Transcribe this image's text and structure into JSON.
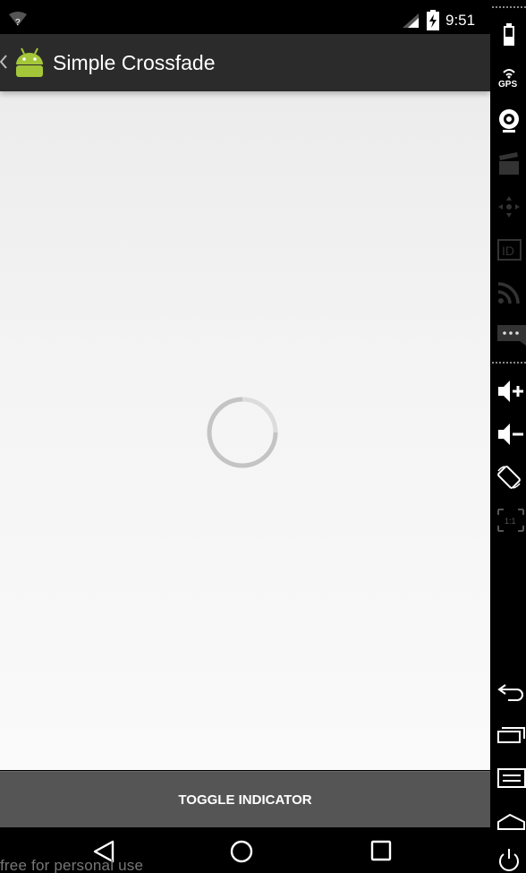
{
  "status_bar": {
    "wifi_badge": "?",
    "time": "9:51",
    "icons": [
      "wifi-icon",
      "signal-icon",
      "battery-charging-icon"
    ]
  },
  "action_bar": {
    "title": "Simple Crossfade",
    "icons": [
      "up-caret-icon",
      "android-app-icon"
    ]
  },
  "content": {
    "indicator": "progress-spinner"
  },
  "toggle_button": {
    "label": "TOGGLE INDICATOR"
  },
  "nav_bar": {
    "buttons": [
      "back-icon",
      "home-icon",
      "recents-icon"
    ]
  },
  "watermark": {
    "text": "free for personal use"
  },
  "side_panel": {
    "gps_label": "GPS",
    "id_label": "ID",
    "scale_label": "1:1",
    "icons": [
      "battery-icon",
      "gps-icon",
      "camera-icon",
      "clapperboard-icon",
      "dpad-icon",
      "id-icon",
      "rss-icon",
      "sms-icon",
      "volume-up-icon",
      "volume-down-icon",
      "rotate-icon",
      "scale-icon",
      "back-arrow-icon",
      "recent-apps-icon",
      "menu-icon",
      "home-icon",
      "power-icon"
    ]
  },
  "colors": {
    "action_bar": "#2b2b2b",
    "button": "#555555",
    "content": "#f4f4f4",
    "android_green": "#a4c639"
  }
}
